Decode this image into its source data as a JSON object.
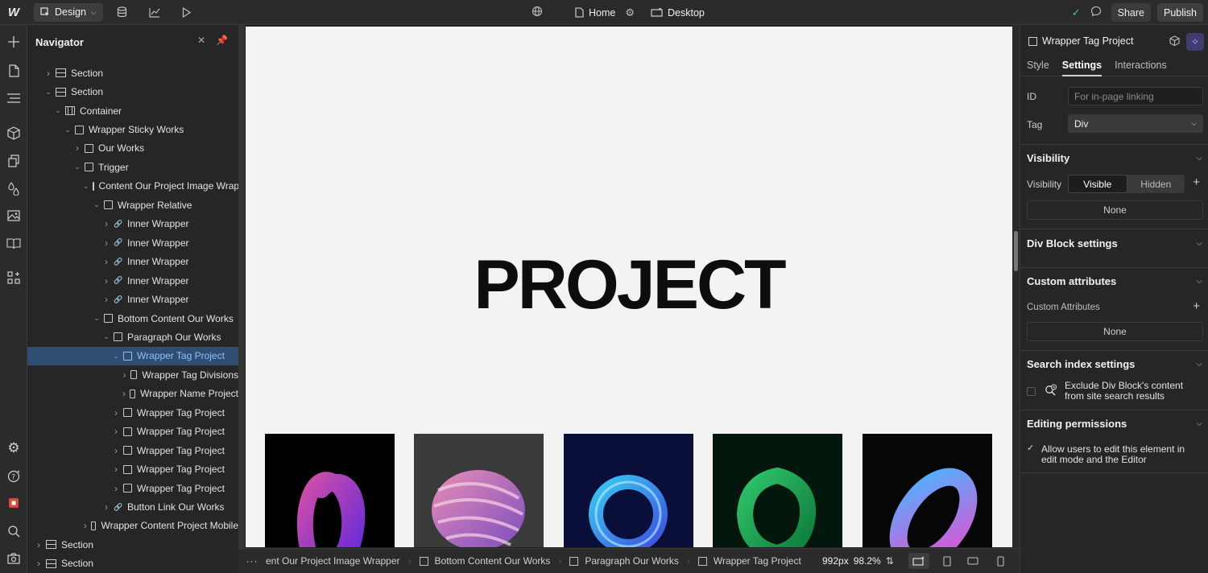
{
  "topbar": {
    "logo": "W",
    "mode_label": "Design",
    "page_label": "Home",
    "breakpoint_label": "Desktop",
    "share_label": "Share",
    "publish_label": "Publish"
  },
  "navigator": {
    "title": "Navigator",
    "rows": [
      {
        "label": "Section",
        "icon": "section",
        "depth": 1,
        "caret": "right"
      },
      {
        "label": "Section",
        "icon": "section",
        "depth": 1,
        "caret": "down"
      },
      {
        "label": "Container",
        "icon": "container",
        "depth": 2,
        "caret": "down"
      },
      {
        "label": "Wrapper Sticky Works",
        "icon": "div",
        "depth": 3,
        "caret": "down"
      },
      {
        "label": "Our  Works",
        "icon": "div",
        "depth": 4,
        "caret": "right"
      },
      {
        "label": "Trigger",
        "icon": "div",
        "depth": 4,
        "caret": "down"
      },
      {
        "label": "Content Our Project Image Wrapper",
        "icon": "div",
        "depth": 5,
        "caret": "down"
      },
      {
        "label": "Wrapper Relative",
        "icon": "div",
        "depth": 6,
        "caret": "down"
      },
      {
        "label": "Inner Wrapper",
        "icon": "link",
        "depth": 7,
        "caret": "right"
      },
      {
        "label": "Inner Wrapper",
        "icon": "link",
        "depth": 7,
        "caret": "right"
      },
      {
        "label": "Inner Wrapper",
        "icon": "link",
        "depth": 7,
        "caret": "right"
      },
      {
        "label": "Inner Wrapper",
        "icon": "link",
        "depth": 7,
        "caret": "right"
      },
      {
        "label": "Inner Wrapper",
        "icon": "link",
        "depth": 7,
        "caret": "right"
      },
      {
        "label": "Bottom Content Our Works",
        "icon": "div",
        "depth": 6,
        "caret": "down"
      },
      {
        "label": "Paragraph Our Works",
        "icon": "div",
        "depth": 7,
        "caret": "down"
      },
      {
        "label": "Wrapper Tag Project",
        "icon": "div",
        "depth": 8,
        "caret": "down",
        "selected": true
      },
      {
        "label": "Wrapper Tag Divisions",
        "icon": "div",
        "depth": 9,
        "caret": "right"
      },
      {
        "label": "Wrapper Name Project",
        "icon": "div",
        "depth": 9,
        "caret": "right"
      },
      {
        "label": "Wrapper Tag Project",
        "icon": "div",
        "depth": 8,
        "caret": "right"
      },
      {
        "label": "Wrapper Tag Project",
        "icon": "div",
        "depth": 8,
        "caret": "right"
      },
      {
        "label": "Wrapper Tag Project",
        "icon": "div",
        "depth": 8,
        "caret": "right"
      },
      {
        "label": "Wrapper Tag Project",
        "icon": "div",
        "depth": 8,
        "caret": "right"
      },
      {
        "label": "Wrapper Tag Project",
        "icon": "div",
        "depth": 8,
        "caret": "right"
      },
      {
        "label": "Button Link Our Works",
        "icon": "link",
        "depth": 7,
        "caret": "right"
      },
      {
        "label": "Wrapper Content Project Mobile",
        "icon": "div",
        "depth": 5,
        "caret": "right"
      },
      {
        "label": "Section",
        "icon": "section",
        "depth": 0,
        "caret": "right"
      },
      {
        "label": "Section",
        "icon": "section",
        "depth": 0,
        "caret": "right"
      }
    ]
  },
  "canvas": {
    "heading": "PROJECT",
    "cards": [
      {
        "name": "card-1",
        "bg": "#000000",
        "accent1": "#d04ea8",
        "accent2": "#6a2bd8"
      },
      {
        "name": "card-2",
        "bg": "#3a3a3a",
        "accent1": "#e98fb6",
        "accent2": "#7a4bbf"
      },
      {
        "name": "card-3",
        "bg": "#0a0f3a",
        "accent1": "#36c8f2",
        "accent2": "#3f4fe0"
      },
      {
        "name": "card-4",
        "bg": "#03170d",
        "accent1": "#2fc46b",
        "accent2": "#0d7a3a"
      },
      {
        "name": "card-5",
        "bg": "#060606",
        "accent1": "#4fb2ff",
        "accent2": "#e24fd2"
      }
    ]
  },
  "breadcrumbs": {
    "items": [
      "ent Our Project Image Wrapper",
      "Bottom Content Our Works",
      "Paragraph Our Works",
      "Wrapper Tag Project"
    ],
    "width_label": "992px",
    "zoom_label": "98.2%"
  },
  "panel": {
    "element_title": "Wrapper Tag Project",
    "tabs": [
      "Style",
      "Settings",
      "Interactions"
    ],
    "active_tab": "Settings",
    "id_label": "ID",
    "id_placeholder": "For in-page linking",
    "tag_label": "Tag",
    "tag_value": "Div",
    "visibility_title": "Visibility",
    "visibility_label": "Visibility",
    "visibility_options": [
      "Visible",
      "Hidden"
    ],
    "visibility_selected": "Visible",
    "visibility_conditions": "None",
    "div_block_title": "Div Block settings",
    "custom_attr_title": "Custom attributes",
    "custom_attr_label": "Custom Attributes",
    "custom_attr_value": "None",
    "search_title": "Search index settings",
    "search_exclude_line1": "Exclude Div Block's content",
    "search_exclude_line2": "from site search results",
    "search_exclude_checked": false,
    "editing_title": "Editing permissions",
    "editing_line1": "Allow users to edit this element in",
    "editing_line2": "edit mode and the Editor",
    "editing_checked": true
  }
}
